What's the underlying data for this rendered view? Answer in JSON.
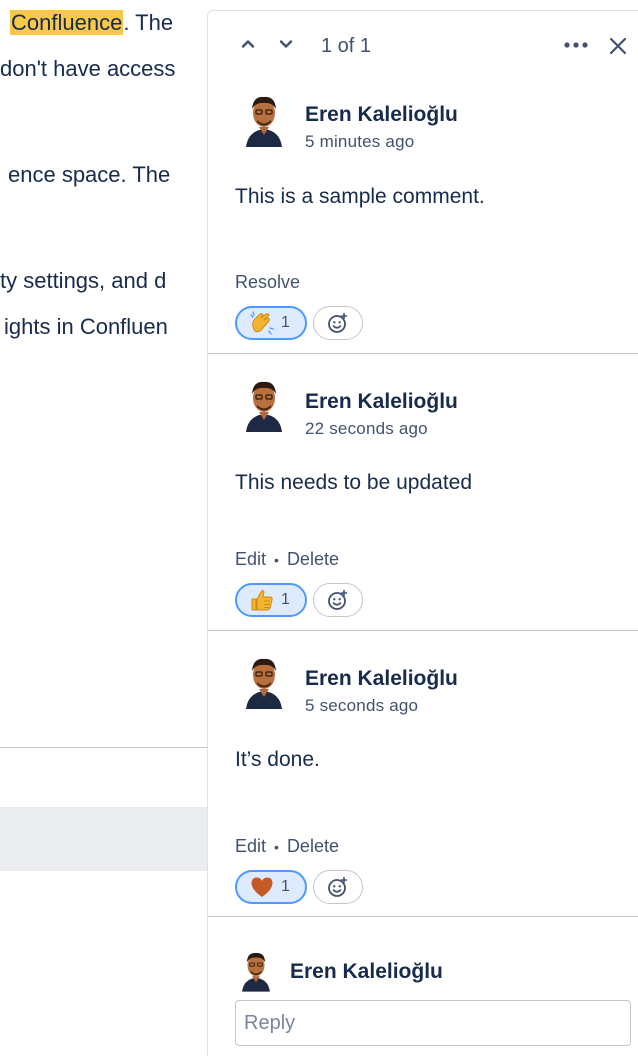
{
  "document": {
    "line1_highlight": "Confluence",
    "line1_rest": ". The",
    "line2": "don't have access",
    "line3": "ence space. The",
    "line4": "ty settings, and d",
    "line5": "ights in Confluen"
  },
  "panel": {
    "counter": "1 of 1",
    "icons": {
      "up": "chevron-up-icon",
      "down": "chevron-down-icon",
      "more": "more-icon",
      "close": "close-icon"
    }
  },
  "comments": [
    {
      "author": "Eren Kalelioğlu",
      "time": "5 minutes ago",
      "body": "This is a sample comment.",
      "actions": [
        "Resolve"
      ],
      "reaction": {
        "emoji": "clapping-hands",
        "count": "1"
      }
    },
    {
      "author": "Eren Kalelioğlu",
      "time": "22 seconds ago",
      "body": "This needs to be updated",
      "actions": [
        "Edit",
        "Delete"
      ],
      "reaction": {
        "emoji": "thumbs-up",
        "count": "1"
      }
    },
    {
      "author": "Eren Kalelioğlu",
      "time": "5 seconds ago",
      "body": "It’s done.",
      "actions": [
        "Edit",
        "Delete"
      ],
      "reaction": {
        "emoji": "heart",
        "count": "1"
      }
    }
  ],
  "reply": {
    "author": "Eren Kalelioğlu",
    "placeholder": "Reply"
  },
  "colors": {
    "highlight": "#F8C84A",
    "reaction_active_bg": "#DEEBFF",
    "reaction_active_border": "#4C9AFF",
    "text": "#172B4D"
  }
}
